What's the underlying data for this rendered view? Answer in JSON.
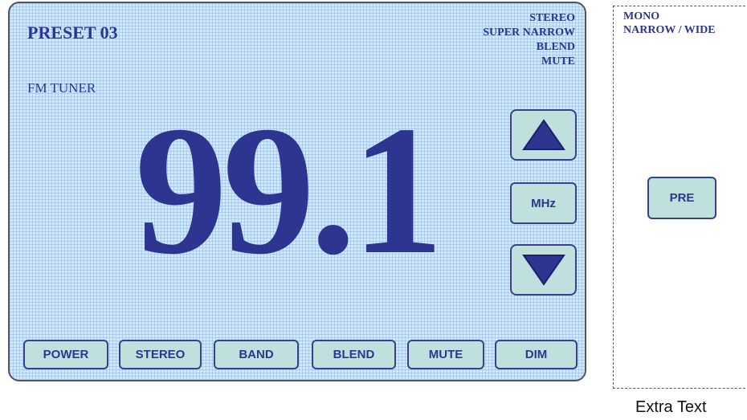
{
  "display": {
    "preset": "PRESET 03",
    "source": "FM TUNER",
    "frequency": "99.1",
    "status_indicators": [
      "STEREO",
      "SUPER NARROW",
      "BLEND",
      "MUTE"
    ]
  },
  "tuning": {
    "up_icon": "triangle-up",
    "unit_label": "MHz",
    "down_icon": "triangle-down"
  },
  "bottom_buttons": [
    "POWER",
    "STEREO",
    "BAND",
    "BLEND",
    "MUTE",
    "DIM"
  ],
  "extra_panel": {
    "labels": [
      "MONO",
      "NARROW / WIDE"
    ],
    "pre_button": "PRE",
    "caption": "Extra Text"
  },
  "colors": {
    "lcd_background": "#cfe8fa",
    "text_accent": "#2e3590",
    "button_fill": "#bfe0dc"
  }
}
